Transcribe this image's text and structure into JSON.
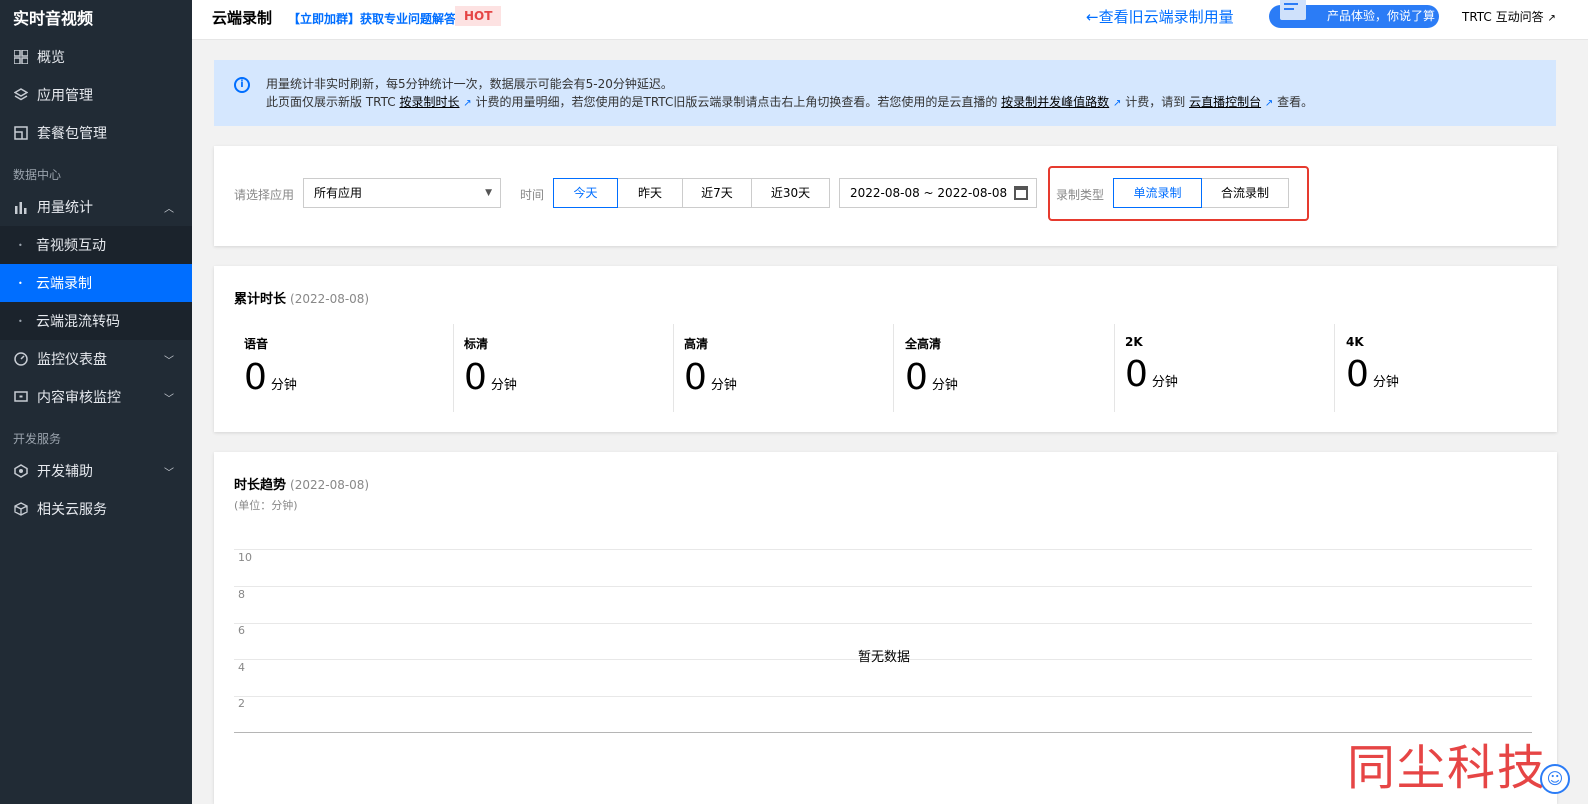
{
  "sidebar": {
    "title": "实时音视频",
    "items_top": [
      {
        "label": "概览",
        "icon": "grid-icon"
      },
      {
        "label": "应用管理",
        "icon": "layers-icon"
      },
      {
        "label": "套餐包管理",
        "icon": "package-icon"
      }
    ],
    "group_data": "数据中心",
    "usage_stats": "用量统计",
    "sub_items": [
      "音视频互动",
      "云端录制",
      "云端混流转码"
    ],
    "items_mid": [
      {
        "label": "监控仪表盘",
        "icon": "gauge-icon"
      },
      {
        "label": "内容审核监控",
        "icon": "monitor-icon"
      }
    ],
    "group_dev": "开发服务",
    "items_dev": [
      {
        "label": "开发辅助",
        "icon": "hexagon-icon"
      },
      {
        "label": "相关云服务",
        "icon": "cube-icon"
      }
    ]
  },
  "topbar": {
    "title": "云端录制",
    "promo": "【立即加群】获取专业问题解答",
    "hot": "HOT",
    "old_link": "查看旧云端录制用量",
    "experience": "产品体验，你说了算",
    "qa": "TRTC 互动问答"
  },
  "info": {
    "line1": "用量统计非实时刷新，每5分钟统计一次，数据展示可能会有5-20分钟延迟。",
    "l2_a": "此页面仅展示新版 TRTC",
    "l2_link1": "按录制时长",
    "l2_b": "计费的用量明细，若您使用的是TRTC旧版云端录制请点击右上角切换查看。若您使用的是云直播的",
    "l2_link2": "按录制并发峰值路数",
    "l2_c": "计费，请到",
    "l2_link3": "云直播控制台",
    "l2_d": "查看。"
  },
  "filter": {
    "app_label": "请选择应用",
    "app_value": "所有应用",
    "time_label": "时间",
    "time_options": [
      "今天",
      "昨天",
      "近7天",
      "近30天"
    ],
    "date_range": "2022-08-08 ~ 2022-08-08",
    "type_label": "录制类型",
    "type_options": [
      "单流录制",
      "合流录制"
    ]
  },
  "cumulative": {
    "title": "累计时长",
    "date": "(2022-08-08)",
    "stats": [
      {
        "name": "语音",
        "value": "0",
        "unit": "分钟"
      },
      {
        "name": "标清",
        "value": "0",
        "unit": "分钟"
      },
      {
        "name": "高清",
        "value": "0",
        "unit": "分钟"
      },
      {
        "name": "全高清",
        "value": "0",
        "unit": "分钟"
      },
      {
        "name": "2K",
        "value": "0",
        "unit": "分钟"
      },
      {
        "name": "4K",
        "value": "0",
        "unit": "分钟"
      }
    ]
  },
  "trend": {
    "title": "时长趋势",
    "date": "(2022-08-08)",
    "unit": "(单位：分钟)",
    "no_data": "暂无数据"
  },
  "chart_data": {
    "type": "line",
    "title": "时长趋势",
    "yticks": [
      "10",
      "8",
      "6",
      "4",
      "2"
    ],
    "series": []
  },
  "watermark": "同尘科技",
  "colors": {
    "accent": "#006eff",
    "sidebar": "#212b35",
    "highlight": "#e63a2e"
  }
}
